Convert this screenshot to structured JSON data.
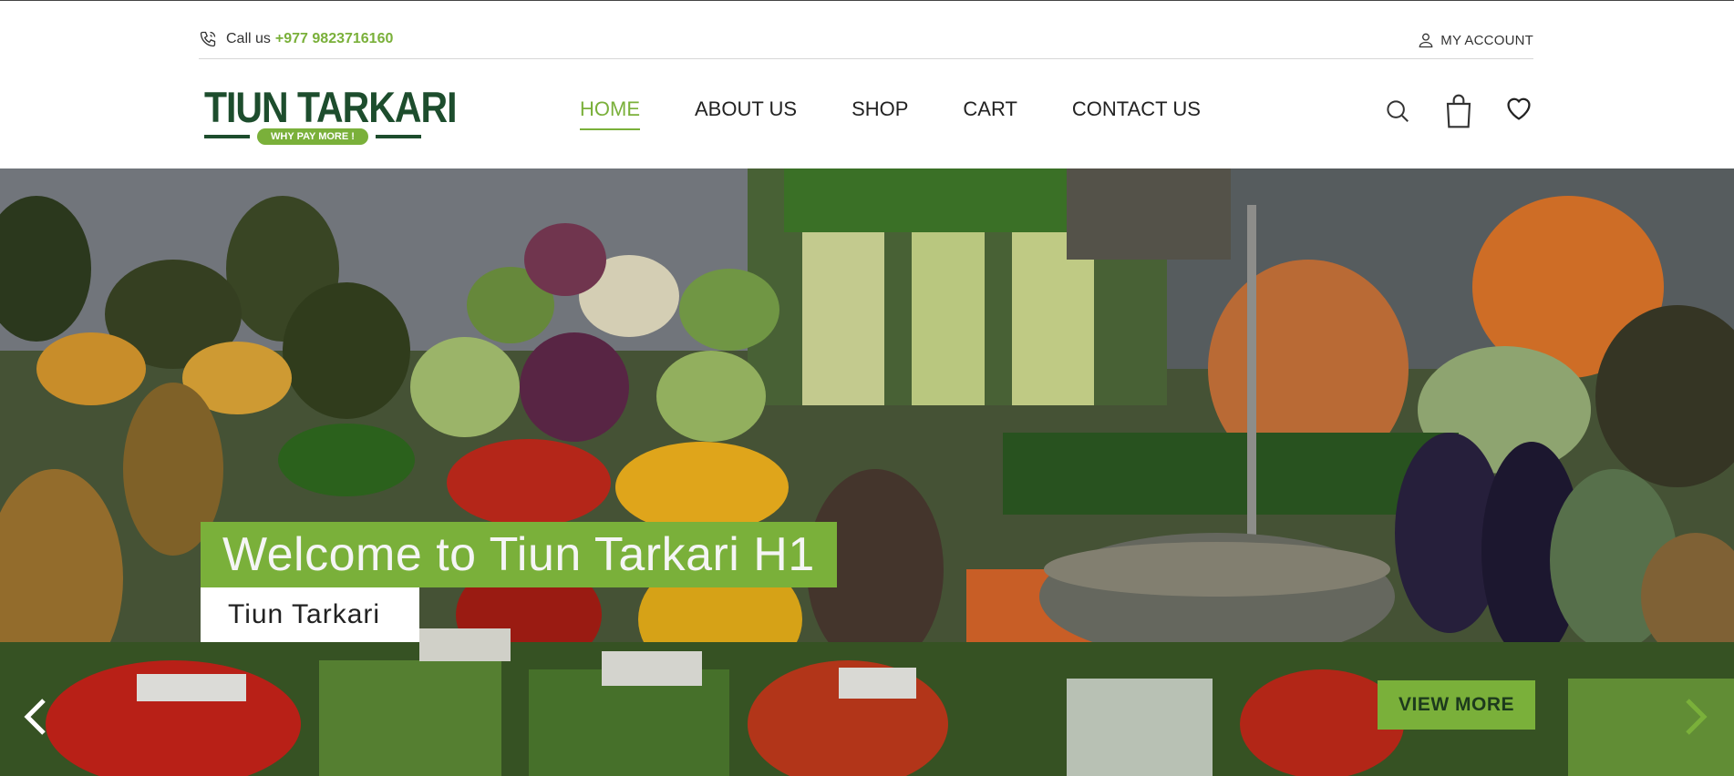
{
  "header": {
    "call_label": "Call us",
    "phone": "+977 9823716160",
    "account_label": "MY ACCOUNT"
  },
  "logo": {
    "name": "TIUN TARKARI",
    "tagline": "WHY PAY MORE !"
  },
  "nav": {
    "items": [
      {
        "label": "HOME",
        "active": true
      },
      {
        "label": "ABOUT US",
        "active": false
      },
      {
        "label": "SHOP",
        "active": false
      },
      {
        "label": "CART",
        "active": false
      },
      {
        "label": "CONTACT US",
        "active": false
      }
    ]
  },
  "header_icons": [
    "search-icon",
    "shopping-bag-icon",
    "heart-icon"
  ],
  "hero": {
    "title": "Welcome to Tiun Tarkari H1",
    "subtitle": "Tiun Tarkari",
    "cta_label": "VIEW MORE",
    "prev_icon": "chevron-left-icon",
    "next_icon": "chevron-right-icon"
  },
  "colors": {
    "accent": "#7ab03a",
    "brand_dark": "#1d4d2d"
  }
}
